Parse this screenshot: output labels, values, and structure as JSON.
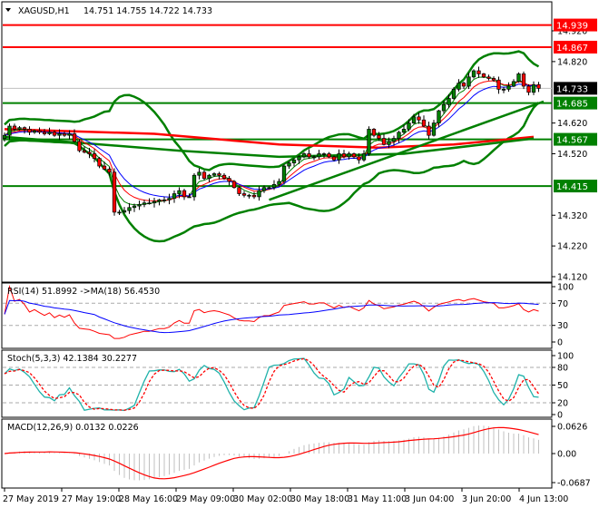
{
  "header": {
    "symbol": "XAGUSD,H1",
    "ohlc": "14.751 14.755 14.722 14.733"
  },
  "colors": {
    "bull": "#008000",
    "bear": "#ff0000",
    "band": "#008000",
    "level_red": "#ff0000",
    "level_green": "#008000",
    "rsi": "#ff0000",
    "rsi_ma": "#0000ff",
    "stoch_main": "#20b2aa",
    "stoch_signal": "#ff0000",
    "macd_signal": "#ff0000",
    "macd_hist": "#c0c0c0"
  },
  "chart_data": {
    "type": "candlestick",
    "title": "XAGUSD,H1",
    "ylim": [
      14.12,
      14.92
    ],
    "price_ticks": [
      "14.920",
      "14.820",
      "14.620",
      "14.520",
      "14.320",
      "14.220",
      "14.120"
    ],
    "time_labels": [
      "27 May 2019",
      "27 May 19:00",
      "28 May 16:00",
      "29 May 09:00",
      "30 May 02:00",
      "30 May 18:00",
      "31 May 11:00",
      "3 Jun 04:00",
      "3 Jun 20:00",
      "4 Jun 13:00"
    ],
    "close": [
      14.58,
      14.61,
      14.6,
      14.605,
      14.6,
      14.59,
      14.595,
      14.59,
      14.585,
      14.59,
      14.58,
      14.585,
      14.58,
      14.585,
      14.56,
      14.53,
      14.525,
      14.52,
      14.505,
      14.48,
      14.47,
      14.46,
      14.33,
      14.33,
      14.335,
      14.345,
      14.35,
      14.355,
      14.36,
      14.36,
      14.365,
      14.37,
      14.37,
      14.375,
      14.39,
      14.4,
      14.38,
      14.38,
      14.45,
      14.46,
      14.44,
      14.45,
      14.455,
      14.45,
      14.44,
      14.43,
      14.41,
      14.39,
      14.385,
      14.385,
      14.38,
      14.4,
      14.41,
      14.41,
      14.42,
      14.43,
      14.48,
      14.49,
      14.5,
      14.51,
      14.52,
      14.51,
      14.51,
      14.52,
      14.52,
      14.51,
      14.5,
      14.52,
      14.51,
      14.52,
      14.51,
      14.5,
      14.52,
      14.6,
      14.58,
      14.57,
      14.55,
      14.56,
      14.57,
      14.59,
      14.6,
      14.62,
      14.64,
      14.63,
      14.61,
      14.58,
      14.62,
      14.66,
      14.68,
      14.7,
      14.73,
      14.75,
      14.74,
      14.77,
      14.79,
      14.78,
      14.77,
      14.765,
      14.76,
      14.73,
      14.73,
      14.74,
      14.755,
      14.78,
      14.74,
      14.72,
      14.745,
      14.733
    ],
    "levels": [
      {
        "label": "14.939",
        "value": 14.939,
        "color": "#ff0000"
      },
      {
        "label": "14.867",
        "value": 14.867,
        "color": "#ff0000"
      },
      {
        "label": "14.733",
        "value": 14.733,
        "color": "#000000",
        "current": true
      },
      {
        "label": "14.685",
        "value": 14.685,
        "color": "#008000"
      },
      {
        "label": "14.567",
        "value": 14.567,
        "color": "#008000"
      },
      {
        "label": "14.415",
        "value": 14.415,
        "color": "#008000"
      }
    ],
    "trendline": [
      [
        53,
        14.37
      ],
      [
        108,
        14.69
      ]
    ],
    "ma_red": [
      [
        0,
        14.6
      ],
      [
        30,
        14.585
      ],
      [
        55,
        14.55
      ],
      [
        75,
        14.54
      ],
      [
        90,
        14.55
      ],
      [
        106,
        14.575
      ]
    ],
    "ma_green": [
      [
        0,
        14.575
      ],
      [
        35,
        14.53
      ],
      [
        55,
        14.51
      ],
      [
        80,
        14.52
      ],
      [
        106,
        14.57
      ]
    ],
    "indicators": {
      "rsi": {
        "label": "RSI(14) 51.8992  ->MA(18) 56.4530",
        "ticks": [
          "100",
          "70",
          "30",
          "0"
        ]
      },
      "stoch": {
        "label": "Stoch(5,3,3) 42.1384 30.2277",
        "ticks": [
          "100",
          "80",
          "50",
          "20",
          "0"
        ]
      },
      "macd": {
        "label": "MACD(12,26,9) 0.0132 0.0226",
        "ticks": [
          "0.0626",
          "0.00",
          "-0.0687"
        ],
        "range": [
          -0.0687,
          0.0626
        ]
      }
    }
  }
}
